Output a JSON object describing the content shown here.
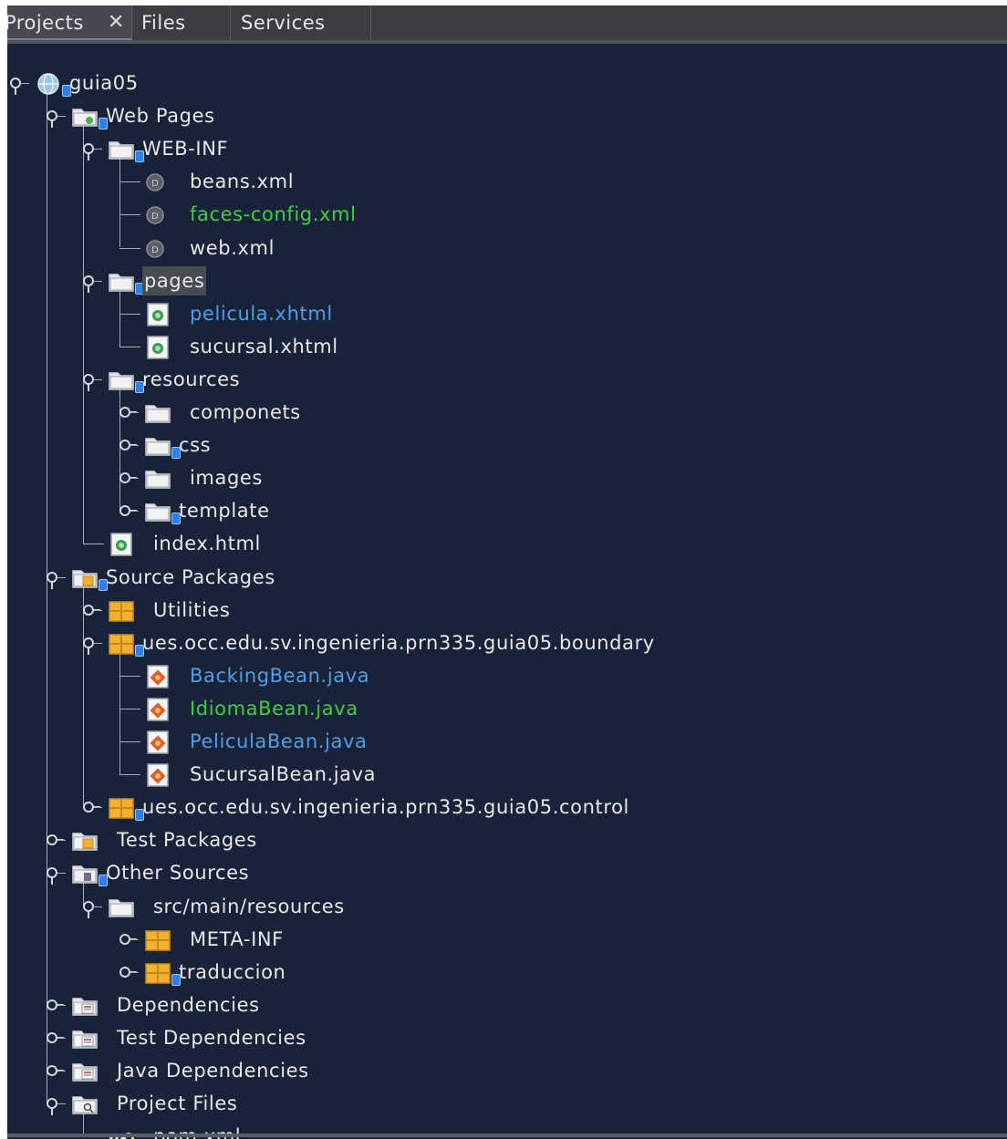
{
  "tabs": [
    {
      "label": "Projects",
      "active": true,
      "closable": true
    },
    {
      "label": "Files",
      "active": false
    },
    {
      "label": "Services",
      "active": false
    }
  ],
  "tree": [
    {
      "label": "guia05",
      "icon": "web-project-icon",
      "handle": "expanded"
    },
    {
      "label": "Web Pages",
      "icon": "web-folder-icon",
      "handle": "expanded"
    },
    {
      "label": "WEB-INF",
      "icon": "folder-icon",
      "handle": "expanded"
    },
    {
      "label": "beans.xml",
      "icon": "xml-file-icon"
    },
    {
      "label": "faces-config.xml",
      "icon": "xml-file-icon",
      "color": "#39d23c"
    },
    {
      "label": "web.xml",
      "icon": "xml-file-icon"
    },
    {
      "label": "pages",
      "icon": "folder-icon",
      "handle": "expanded",
      "selected": true
    },
    {
      "label": "pelicula.xhtml",
      "icon": "xhtml-file-icon",
      "color": "#4f9ee8"
    },
    {
      "label": "sucursal.xhtml",
      "icon": "xhtml-file-icon"
    },
    {
      "label": "resources",
      "icon": "folder-icon",
      "handle": "expanded"
    },
    {
      "label": "componets",
      "icon": "folder-icon",
      "handle": "collapsed"
    },
    {
      "label": "css",
      "icon": "folder-icon",
      "handle": "collapsed"
    },
    {
      "label": "images",
      "icon": "folder-icon",
      "handle": "collapsed"
    },
    {
      "label": "template",
      "icon": "folder-icon",
      "handle": "collapsed"
    },
    {
      "label": "index.html",
      "icon": "html-file-icon"
    },
    {
      "label": "Source Packages",
      "icon": "source-packages-icon",
      "handle": "expanded"
    },
    {
      "label": "Utilities",
      "icon": "package-icon",
      "handle": "collapsed"
    },
    {
      "label": "ues.occ.edu.sv.ingenieria.prn335.guia05.boundary",
      "icon": "package-icon",
      "handle": "expanded"
    },
    {
      "label": "BackingBean.java",
      "icon": "java-file-icon",
      "color": "#4f9ee8"
    },
    {
      "label": "IdiomaBean.java",
      "icon": "java-file-icon",
      "color": "#39d23c"
    },
    {
      "label": "PeliculaBean.java",
      "icon": "java-file-icon",
      "color": "#4f9ee8"
    },
    {
      "label": "SucursalBean.java",
      "icon": "java-file-icon"
    },
    {
      "label": "ues.occ.edu.sv.ingenieria.prn335.guia05.control",
      "icon": "package-icon",
      "handle": "collapsed"
    },
    {
      "label": "Test Packages",
      "icon": "test-packages-icon",
      "handle": "collapsed"
    },
    {
      "label": "Other Sources",
      "icon": "other-sources-icon",
      "handle": "expanded"
    },
    {
      "label": "src/main/resources",
      "icon": "folder-icon",
      "handle": "expanded"
    },
    {
      "label": "META-INF",
      "icon": "package-icon",
      "handle": "collapsed"
    },
    {
      "label": "traduccion",
      "icon": "package-icon",
      "handle": "collapsed"
    },
    {
      "label": "Dependencies",
      "icon": "library-icon",
      "handle": "collapsed"
    },
    {
      "label": "Test Dependencies",
      "icon": "library-icon",
      "handle": "collapsed"
    },
    {
      "label": "Java Dependencies",
      "icon": "library-icon",
      "handle": "collapsed"
    },
    {
      "label": "Project Files",
      "icon": "project-files-icon",
      "handle": "expanded"
    },
    {
      "label": "pom.xml",
      "icon": "maven-file-icon"
    }
  ]
}
